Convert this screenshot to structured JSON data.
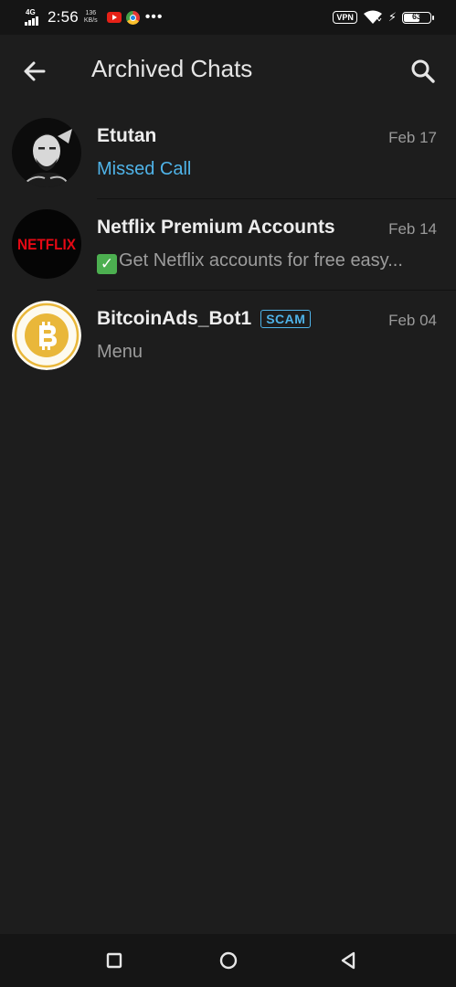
{
  "status_bar": {
    "network": "4G",
    "time": "2:56",
    "speed_value": "136",
    "speed_unit": "KB/s",
    "vpn": "VPN",
    "battery": "63",
    "battery_level": 0.63
  },
  "header": {
    "title": "Archived Chats",
    "back_icon": "arrow-back-icon",
    "search_icon": "search-icon"
  },
  "chats": [
    {
      "name": "Etutan",
      "date": "Feb 17",
      "message": "Missed Call",
      "message_color": "#4fb3e8"
    },
    {
      "name": "Netflix Premium Accounts",
      "date": "Feb 14",
      "message": "Get Netflix accounts for free easy...",
      "avatar_text": "NETFLIX"
    },
    {
      "name": "BitcoinAds_Bot1",
      "badge": "SCAM",
      "date": "Feb 04",
      "message": "Menu"
    }
  ],
  "nav": {
    "recents_icon": "square-icon",
    "home_icon": "circle-icon",
    "back_icon": "triangle-back-icon"
  },
  "colors": {
    "background": "#1d1d1d",
    "accent": "#4fb3e8",
    "netflix_red": "#e50914",
    "bitcoin_gold": "#e9b73a"
  }
}
